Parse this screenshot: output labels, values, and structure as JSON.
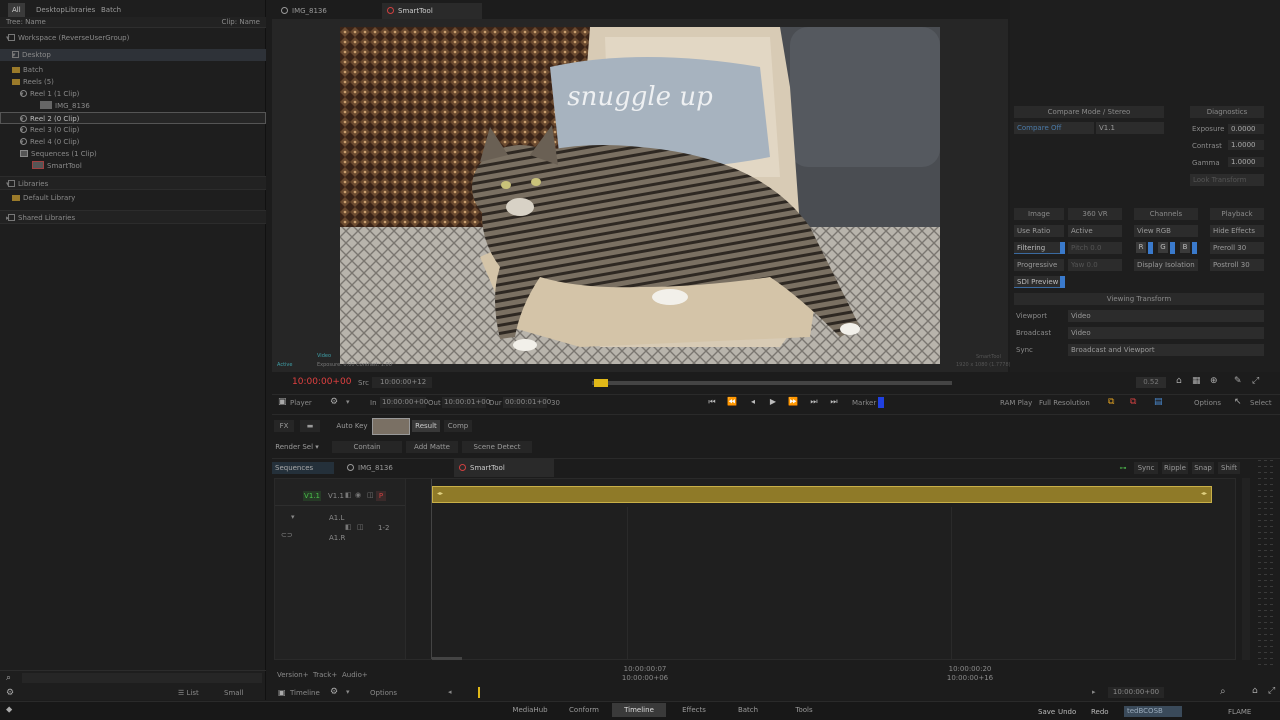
{
  "left_panel": {
    "tabs": [
      "All",
      "Desktop",
      "Libraries",
      "Batch"
    ],
    "tree_label": "Tree: Name",
    "clip_label": "Clip: Name",
    "workspace": "Workspace (ReverseUserGroup)",
    "desktop": "Desktop",
    "batch": "Batch",
    "reels": "Reels (5)",
    "reel1": "Reel 1 (1 Clip)",
    "clip_img": "IMG_8136",
    "reel2": "Reel 2 (0 Clip)",
    "reel3": "Reel 3 (0 Clip)",
    "reel4": "Reel 4 (0 Clip)",
    "sequences": "Sequences (1 Clip)",
    "smarttool": "SmartTool",
    "libraries": "Libraries",
    "default_library": "Default Library",
    "shared_libraries": "Shared Libraries",
    "bottom_list": "List",
    "bottom_small": "Small"
  },
  "viewer": {
    "tabs": [
      "IMG_8136",
      "SmartTool"
    ],
    "pillow_text": "snuggle up",
    "overlay_active": "Active",
    "overlay_video": "Video",
    "overlay_exposure": "Exposure: 0.00   Contrast: 1.00",
    "overlay_right1": "SmartTool",
    "overlay_right2": "1920 x 1080 (1.7778)"
  },
  "right_panel": {
    "compare_mode": "Compare Mode / Stereo",
    "compare_off": "Compare Off",
    "compare_v": "V1.1",
    "diagnostics": "Diagnostics",
    "exposure_label": "Exposure",
    "exposure_val": "0.0000",
    "contrast_label": "Contrast",
    "contrast_val": "1.0000",
    "gamma_label": "Gamma",
    "gamma_val": "1.0000",
    "look_transform": "Look Transform",
    "image": "Image",
    "vr360": "360 VR",
    "channels": "Channels",
    "playback": "Playback",
    "use_ratio": "Use Ratio",
    "active": "Active",
    "view_rgb": "View RGB",
    "hide_effects": "Hide Effects",
    "filtering": "Filtering",
    "pitch": "Pitch 0.0",
    "r": "R",
    "g": "G",
    "b": "B",
    "preroll": "Preroll 30",
    "progressive": "Progressive",
    "yaw": "Yaw 0.0",
    "display_isolation": "Display Isolation",
    "postroll": "Postroll 30",
    "sdi_preview": "SDI Preview",
    "viewing_transform": "Viewing Transform",
    "viewport": "Viewport",
    "viewport_val": "Video",
    "broadcast": "Broadcast",
    "broadcast_val": "Video",
    "sync": "Sync",
    "sync_val": "Broadcast and Viewport",
    "zoom_val": "0.52"
  },
  "transport": {
    "timecode": "10:00:00+00",
    "src_label": "Src",
    "src_tc": "10:00:00+12",
    "player": "Player",
    "in_label": "In",
    "in_tc": "10:00:00+00",
    "out_label": "Out",
    "out_tc": "10:00:01+00",
    "dur_label": "Dur",
    "dur_tc": "00:00:01+00",
    "fps": "30",
    "marker": "Marker",
    "ram_play": "RAM Play",
    "full_res": "Full Resolution",
    "options": "Options",
    "select": "Select"
  },
  "toolbar": {
    "fx": "FX",
    "auto_key": "Auto Key",
    "result": "Result",
    "comp": "Comp",
    "render_sel": "Render Sel",
    "contain": "Contain",
    "add_matte": "Add Matte",
    "scene_detect": "Scene Detect"
  },
  "timeline": {
    "sequences_tab": "Sequences",
    "seq_tabs": [
      "IMG_8136",
      "SmartTool"
    ],
    "sync": "Sync",
    "ripple": "Ripple",
    "snap": "Snap",
    "shift": "Shift",
    "v_patch": "V1.1",
    "v_track": "V1.1",
    "p_label": "P",
    "a_track1": "A1.L",
    "a_patch": "1-2",
    "a_track2": "A1.R",
    "ruler1_a": "10:00:00:07",
    "ruler1_b": "10:00:00+06",
    "ruler2_a": "10:00:00:20",
    "ruler2_b": "10:00:00+16",
    "version": "Version+",
    "track": "Track+",
    "audio": "Audio+",
    "timeline_label": "Timeline",
    "options": "Options",
    "nav_tc": "10:00:00+00"
  },
  "footer": {
    "tabs": [
      "MediaHub",
      "Conform",
      "Timeline",
      "Effects",
      "Batch",
      "Tools"
    ],
    "save": "Save",
    "undo": "Undo",
    "redo": "Redo",
    "user": "tedBCOSB",
    "app": "FLAME"
  }
}
